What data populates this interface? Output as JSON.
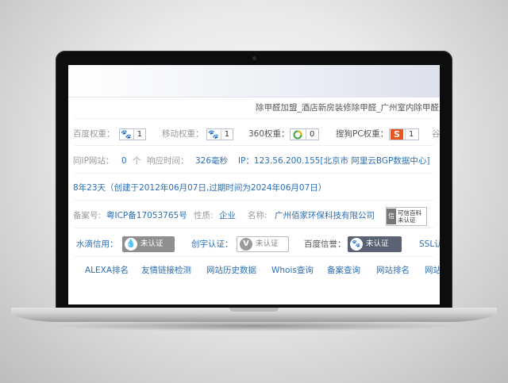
{
  "title_link": "除甲醛加盟_酒店新房装修除甲醛_广州室内除甲醛治理公",
  "weights": {
    "baidu_label": "百度权重：",
    "baidu_value": "1",
    "mobile_label": "移动权重：",
    "mobile_value": "1",
    "w360_label": "360权重：",
    "w360_value": "0",
    "sogou_label": "搜狗PC权重：",
    "sogou_value": "1",
    "tail_label": "谷"
  },
  "ip_row": {
    "same_ip_label": "同IP网站：",
    "same_ip_value": "0",
    "same_ip_unit": "个",
    "resp_label": "响应时间：",
    "resp_value": "326毫秒",
    "ip_text": "IP：123.56.200.155[北京市 阿里云BGP数据中心]"
  },
  "age_text": "8年23天（创建于2012年06月07日,过期时间为2024年06月07日）",
  "icp_row": {
    "icp_label": "备案号:",
    "icp_value": "粤ICP备17053765号",
    "nature_label": "性质:",
    "nature_value": "企业",
    "name_label": "名称:",
    "name_value": "广州佰家环保科技有限公司",
    "baike_line1": "可信百科",
    "baike_line2": "未认证"
  },
  "certs": {
    "shuidi_label": "水滴信用：",
    "shuidi_status": "未认证",
    "chuangyu_label": "创宇认证：",
    "chuangyu_status": "未认证",
    "baidu_xinyu_label": "百度信誉：",
    "baidu_xinyu_status": "未认证",
    "ssl_label": "SSL认"
  },
  "links": [
    "ALEXA排名",
    "友情链接检测",
    "网站历史数据",
    "Whois查询",
    "备案查询",
    "网站排名",
    "网站"
  ]
}
